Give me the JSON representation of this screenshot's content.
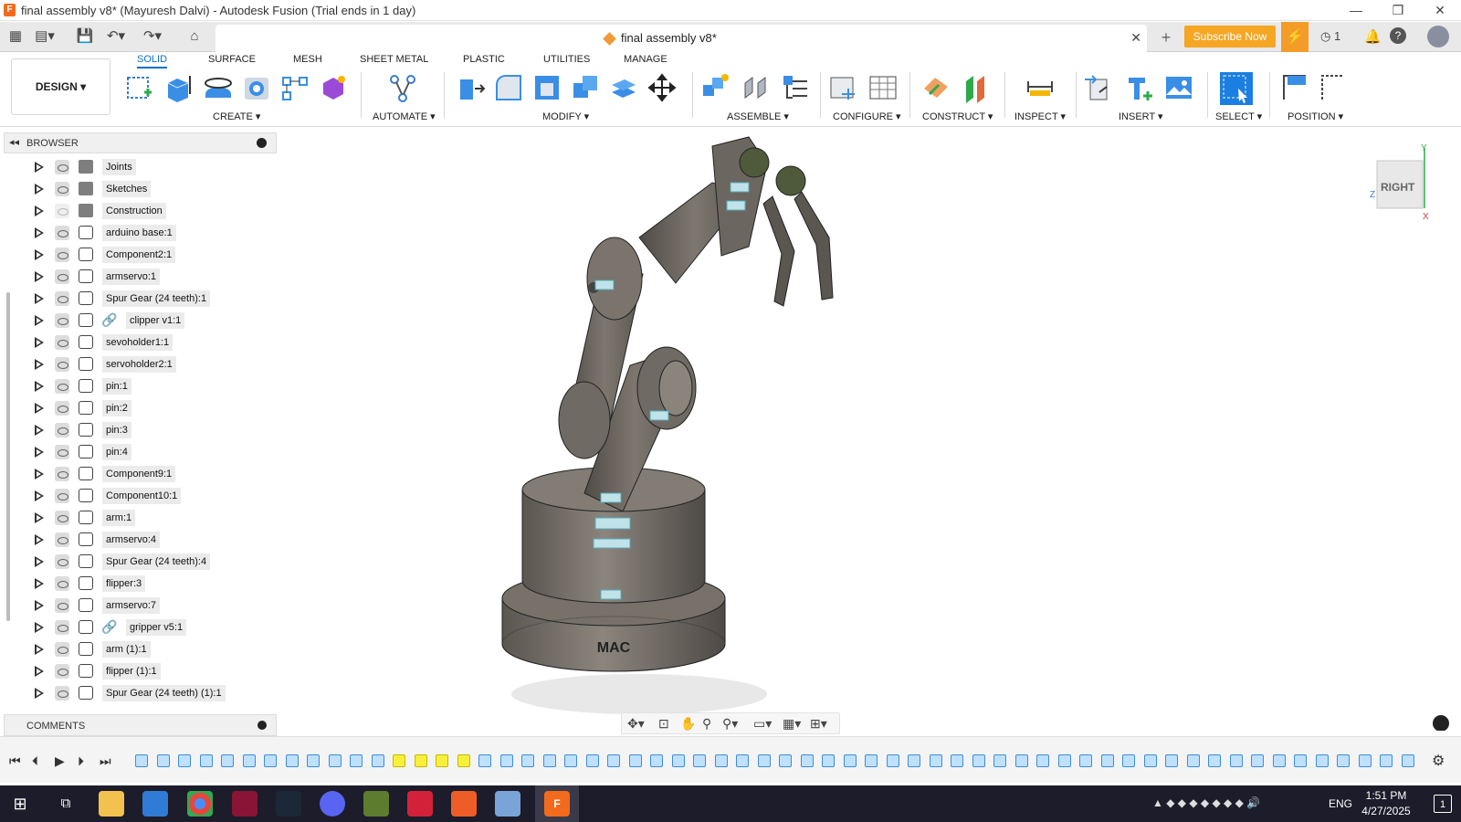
{
  "window": {
    "title": "final assembly v8* (Mayuresh Dalvi) - Autodesk Fusion (Trial ends in 1 day)",
    "minimize": "—",
    "restore": "❐",
    "close": "✕"
  },
  "tabbar": {
    "doc_title": "final assembly v8*",
    "subscribe_label": "Subscribe Now",
    "jobs_count": "1"
  },
  "ribbon": {
    "design_label": "DESIGN",
    "tabs": [
      "SOLID",
      "SURFACE",
      "MESH",
      "SHEET METAL",
      "PLASTIC",
      "UTILITIES",
      "MANAGE"
    ],
    "groups": [
      "CREATE",
      "AUTOMATE",
      "MODIFY",
      "ASSEMBLE",
      "CONFIGURE",
      "CONSTRUCT",
      "INSPECT",
      "INSERT",
      "SELECT",
      "POSITION"
    ]
  },
  "browser": {
    "title": "BROWSER",
    "items": [
      {
        "label": "Joints",
        "icon": "folder-icon",
        "visible": true
      },
      {
        "label": "Sketches",
        "icon": "folder-icon",
        "visible": true
      },
      {
        "label": "Construction",
        "icon": "folder-icon",
        "visible": false
      },
      {
        "label": "arduino base:1",
        "icon": "component-icon",
        "visible": true
      },
      {
        "label": "Component2:1",
        "icon": "component-icon",
        "visible": true
      },
      {
        "label": "armservo:1",
        "icon": "component-icon",
        "visible": true
      },
      {
        "label": "Spur Gear (24 teeth):1",
        "icon": "component-icon",
        "visible": true
      },
      {
        "label": "clipper v1:1",
        "icon": "component-icon",
        "visible": true,
        "linked": true
      },
      {
        "label": "sevoholder1:1",
        "icon": "component-icon",
        "visible": true
      },
      {
        "label": "servoholder2:1",
        "icon": "component-icon",
        "visible": true
      },
      {
        "label": "pin:1",
        "icon": "component-icon",
        "visible": true
      },
      {
        "label": "pin:2",
        "icon": "component-icon",
        "visible": true
      },
      {
        "label": "pin:3",
        "icon": "component-icon",
        "visible": true
      },
      {
        "label": "pin:4",
        "icon": "component-icon",
        "visible": true
      },
      {
        "label": "Component9:1",
        "icon": "component-icon",
        "visible": true
      },
      {
        "label": "Component10:1",
        "icon": "component-icon",
        "visible": true
      },
      {
        "label": "arm:1",
        "icon": "component-icon",
        "visible": true
      },
      {
        "label": "armservo:4",
        "icon": "component-icon",
        "visible": true
      },
      {
        "label": "Spur Gear (24 teeth):4",
        "icon": "component-icon",
        "visible": true
      },
      {
        "label": "flipper:3",
        "icon": "component-icon",
        "visible": true
      },
      {
        "label": "armservo:7",
        "icon": "component-icon",
        "visible": true
      },
      {
        "label": "gripper v5:1",
        "icon": "component-icon",
        "visible": true,
        "linked": true
      },
      {
        "label": "arm (1):1",
        "icon": "component-icon",
        "visible": true
      },
      {
        "label": "flipper (1):1",
        "icon": "component-icon",
        "visible": true
      },
      {
        "label": "Spur Gear (24 teeth) (1):1",
        "icon": "component-icon",
        "visible": true
      }
    ]
  },
  "comments": {
    "title": "COMMENTS"
  },
  "viewcube": {
    "face": "RIGHT",
    "axes": [
      "Y",
      "Z",
      "X"
    ]
  },
  "model": {
    "base_text": "MAC"
  },
  "taskbar": {
    "time": "1:51 PM",
    "date": "4/27/2025",
    "language": "ENG",
    "notifications": "1"
  },
  "colors": {
    "accent": "#0b6ec9",
    "subscribe": "#f5a623",
    "model_gray": "#6f6a64",
    "taskbar": "#1c1c2a"
  }
}
